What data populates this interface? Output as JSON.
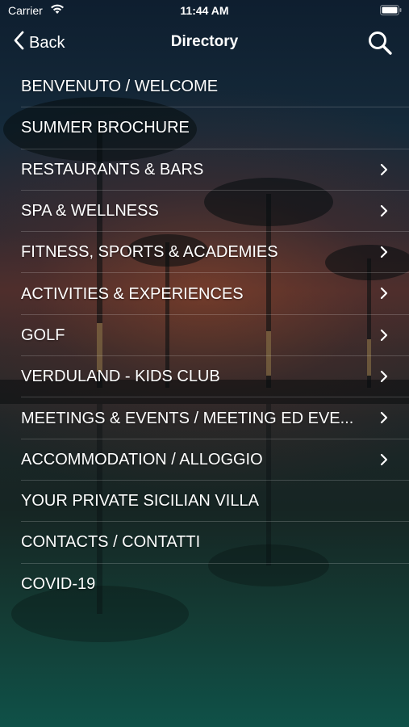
{
  "status_bar": {
    "carrier": "Carrier",
    "time": "11:44 AM"
  },
  "nav": {
    "back_label": "Back",
    "title": "Directory"
  },
  "items": [
    {
      "label": "BENVENUTO / WELCOME",
      "has_chevron": false
    },
    {
      "label": "SUMMER BROCHURE",
      "has_chevron": false
    },
    {
      "label": "RESTAURANTS & BARS",
      "has_chevron": true
    },
    {
      "label": "SPA & WELLNESS",
      "has_chevron": true
    },
    {
      "label": "FITNESS, SPORTS & ACADEMIES",
      "has_chevron": true
    },
    {
      "label": "ACTIVITIES & EXPERIENCES",
      "has_chevron": true
    },
    {
      "label": "GOLF",
      "has_chevron": true
    },
    {
      "label": "VERDULAND - KIDS CLUB",
      "has_chevron": true
    },
    {
      "label": "MEETINGS & EVENTS / MEETING ED EVE...",
      "has_chevron": true
    },
    {
      "label": "ACCOMMODATION / ALLOGGIO",
      "has_chevron": true
    },
    {
      "label": "YOUR PRIVATE SICILIAN VILLA",
      "has_chevron": false
    },
    {
      "label": "CONTACTS / CONTATTI",
      "has_chevron": false
    },
    {
      "label": "COVID-19",
      "has_chevron": false
    }
  ],
  "icons": {
    "wifi": "wifi-icon",
    "battery": "battery-icon",
    "back": "chevron-left-icon",
    "search": "search-icon",
    "disclosure": "chevron-right-icon"
  }
}
